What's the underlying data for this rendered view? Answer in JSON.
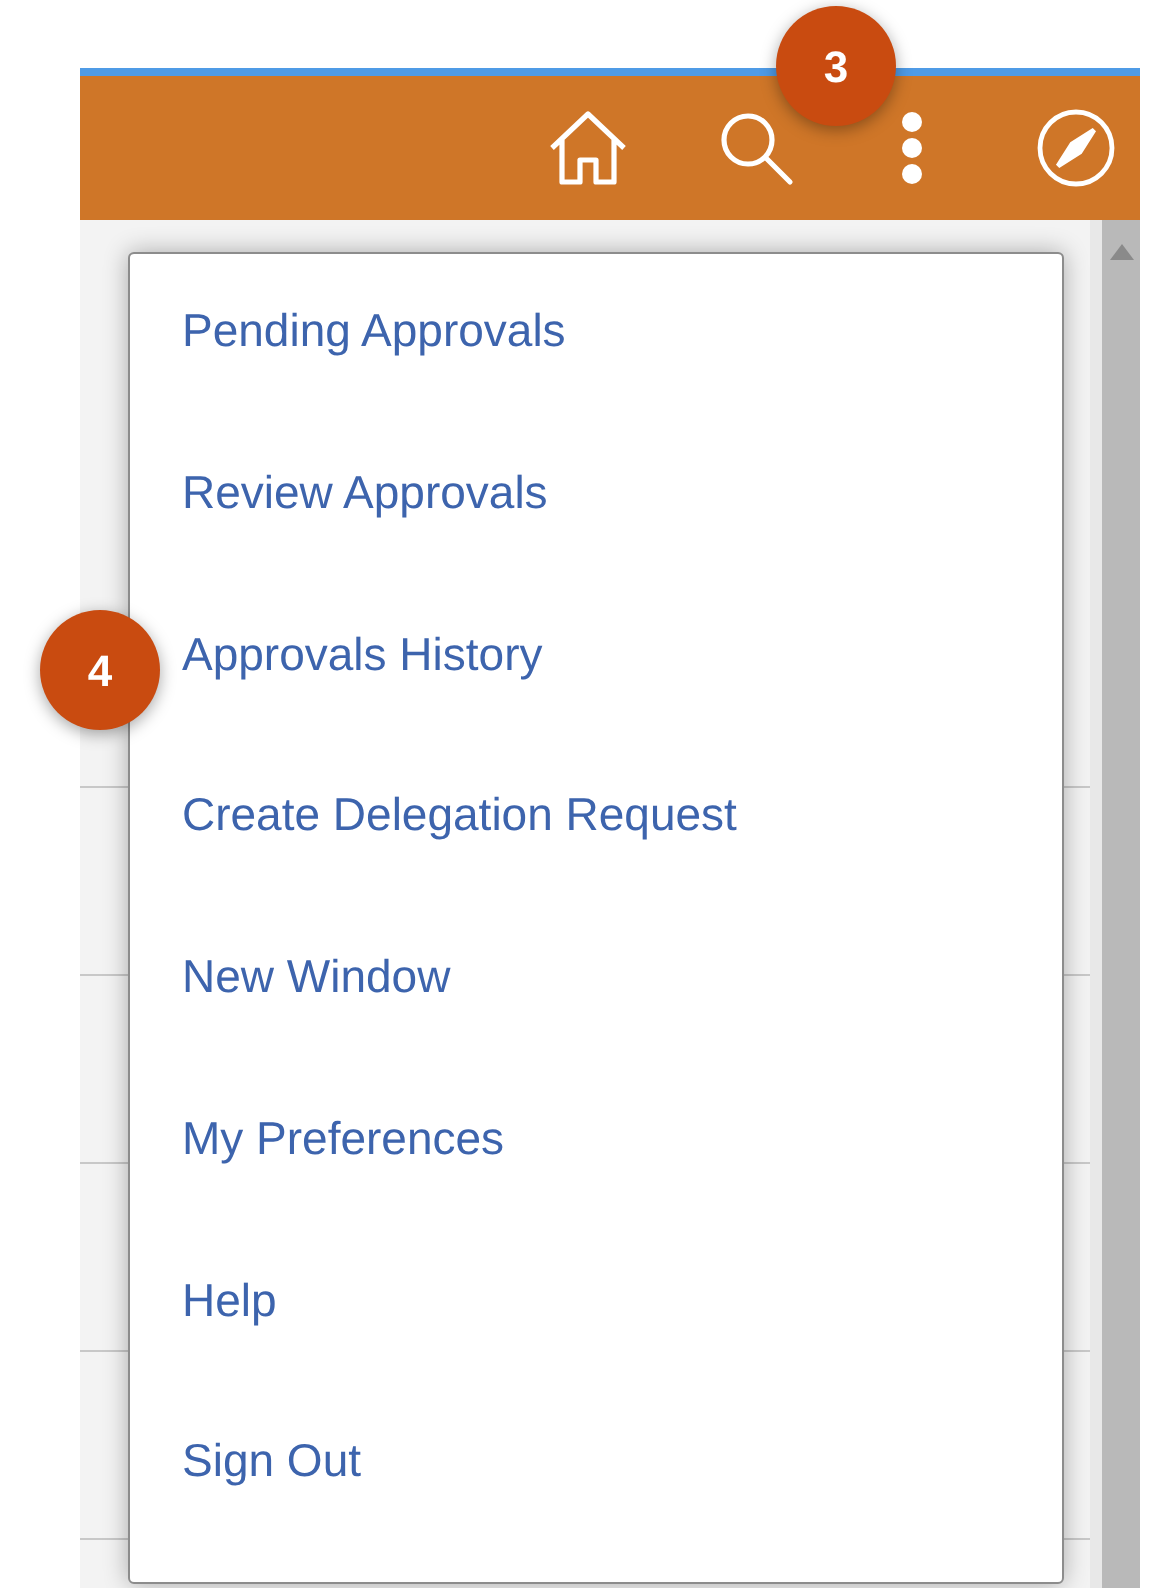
{
  "callouts": [
    {
      "label": "3"
    },
    {
      "label": "4"
    }
  ],
  "menu": {
    "items": [
      {
        "label": "Pending Approvals"
      },
      {
        "label": "Review Approvals"
      },
      {
        "label": "Approvals History"
      },
      {
        "label": "Create Delegation Request"
      },
      {
        "label": "New Window"
      },
      {
        "label": "My Preferences"
      },
      {
        "label": "Help"
      },
      {
        "label": "Sign Out"
      }
    ]
  }
}
